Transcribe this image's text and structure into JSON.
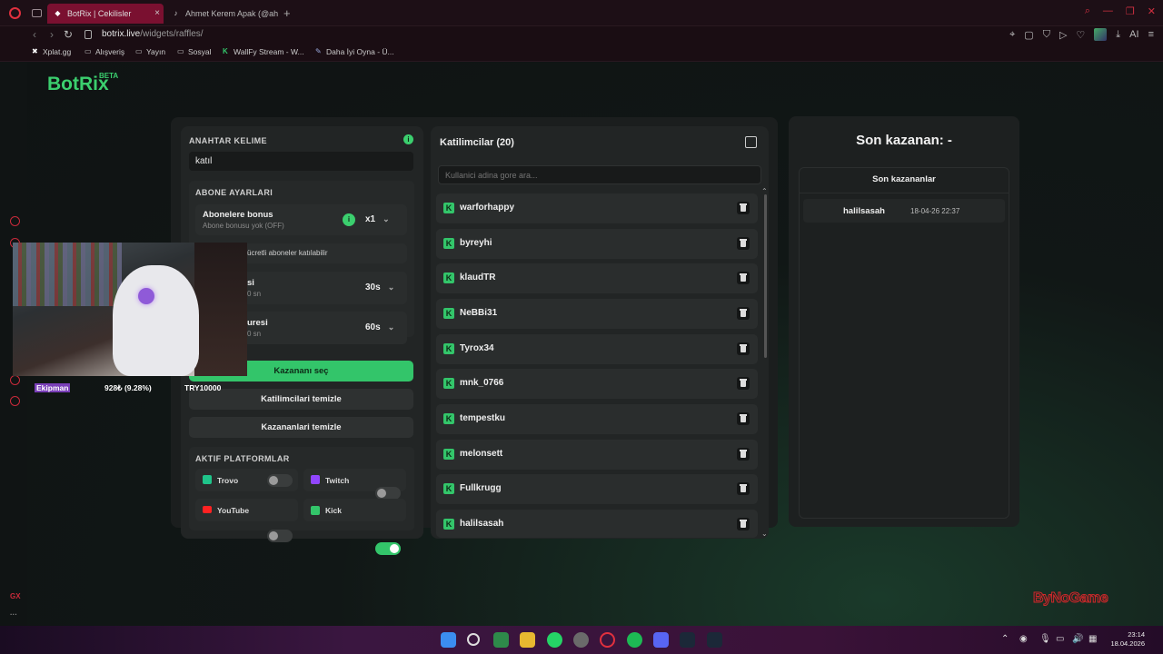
{
  "browser": {
    "tabs": [
      {
        "label": "BotRix | Cekilisler",
        "active": true
      },
      {
        "label": "Ahmet Kerem Apak (@ahm",
        "active": false
      }
    ],
    "url_host": "botrix.live",
    "url_path": "/widgets/raffles/",
    "bookmarks": [
      "Xplat.gg",
      "Alışveriş",
      "Yayın",
      "Sosyal",
      "WallFy Stream - W...",
      "Daha İyi Oyna - Ü..."
    ],
    "right_icon_label": "AI"
  },
  "brand": {
    "name": "BotRix",
    "badge": "BETA"
  },
  "settings": {
    "keyword_label": "ANAHTAR KELIME",
    "keyword_value": "katıl",
    "subscriber_section": "ABONE AYARLARI",
    "sub_bonus_title": "Abonelere bonus",
    "sub_bonus_sub": "Abone bonusu yok (OFF)",
    "sub_bonus_select": "x1",
    "sub_only_text": "ücretli aboneler katılabilir",
    "timer1_title": "si",
    "timer1_sub": "0 sn",
    "timer1_select": "30s",
    "timer2_title": "uresi",
    "timer2_sub": "0 sn",
    "timer2_select": "60s",
    "pick_winner": "Kazananı seç",
    "clear_participants": "Katilimcilari temizle",
    "clear_winners": "Kazananlari temizle",
    "platforms_label": "AKTIF PLATFORMLAR",
    "platforms": [
      {
        "name": "Trovo",
        "on": false,
        "color": "#1fc48a"
      },
      {
        "name": "Twitch",
        "on": false,
        "color": "#9146ff"
      },
      {
        "name": "YouTube",
        "on": false,
        "color": "#ff2222"
      },
      {
        "name": "Kick",
        "on": true,
        "color": "#33c56a"
      }
    ]
  },
  "participants": {
    "title": "Katilimcilar (20)",
    "search_placeholder": "Kullanici adina gore ara...",
    "list": [
      "warforhappy",
      "byreyhi",
      "klaudTR",
      "NeBBi31",
      "Tyrox34",
      "mnk_0766",
      "tempestku",
      "melonsett",
      "Fullkrugg",
      "halilsasah"
    ]
  },
  "winners": {
    "title": "Son kazanan: -",
    "list_title": "Son kazananlar",
    "list": [
      {
        "name": "halilsasah",
        "date": "18-04-26 22:37"
      }
    ]
  },
  "stream_overlay": {
    "name": "Ekipman",
    "stat": "928₺ (9.28%)",
    "goal": "TRY10000"
  },
  "watermark": "ByNoGame",
  "taskbar": {
    "time": "23:14",
    "date": "18.04.2026"
  },
  "colors": {
    "accent": "#33c56a",
    "opera": "#e0303e"
  }
}
